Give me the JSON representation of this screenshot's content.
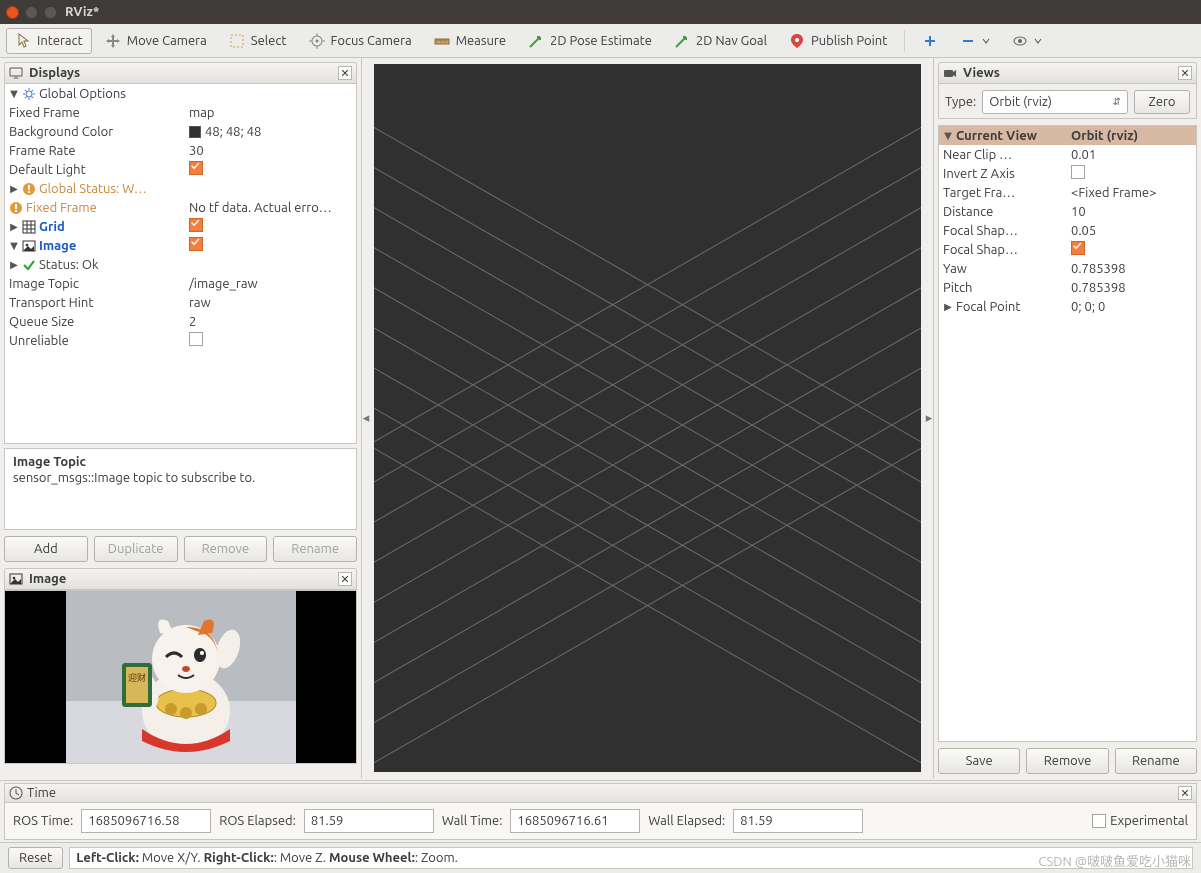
{
  "window": {
    "title": "RViz*"
  },
  "toolbar": {
    "interact": "Interact",
    "move_camera": "Move Camera",
    "select": "Select",
    "focus_camera": "Focus Camera",
    "measure": "Measure",
    "pose_estimate": "2D Pose Estimate",
    "nav_goal": "2D Nav Goal",
    "publish_point": "Publish Point"
  },
  "displays": {
    "title": "Displays",
    "global_options": {
      "label": "Global Options",
      "fixed_frame": {
        "label": "Fixed Frame",
        "value": "map"
      },
      "background_color": {
        "label": "Background Color",
        "value": "48; 48; 48"
      },
      "frame_rate": {
        "label": "Frame Rate",
        "value": "30"
      },
      "default_light": {
        "label": "Default Light",
        "checked": true
      }
    },
    "global_status": {
      "label": "Global Status: W…",
      "fixed_frame": {
        "label": "Fixed Frame",
        "value": "No tf data.  Actual erro…"
      }
    },
    "grid": {
      "label": "Grid",
      "checked": true
    },
    "image": {
      "label": "Image",
      "checked": true,
      "status": {
        "label": "Status: Ok"
      },
      "image_topic": {
        "label": "Image Topic",
        "value": "/image_raw"
      },
      "transport_hint": {
        "label": "Transport Hint",
        "value": "raw"
      },
      "queue_size": {
        "label": "Queue Size",
        "value": "2"
      },
      "unreliable": {
        "label": "Unreliable",
        "checked": false
      }
    },
    "help": {
      "title": "Image Topic",
      "body": "sensor_msgs::Image topic to subscribe to."
    },
    "buttons": {
      "add": "Add",
      "duplicate": "Duplicate",
      "remove": "Remove",
      "rename": "Rename"
    }
  },
  "image_panel": {
    "title": "Image"
  },
  "views": {
    "title": "Views",
    "type_label": "Type:",
    "type_value": "Orbit (rviz)",
    "zero": "Zero",
    "header": {
      "name": "Current View",
      "value": "Orbit (rviz)"
    },
    "rows": {
      "near_clip": {
        "label": "Near Clip …",
        "value": "0.01"
      },
      "invert_z": {
        "label": "Invert Z Axis",
        "checked": false
      },
      "target_frame": {
        "label": "Target Fra…",
        "value": "<Fixed Frame>"
      },
      "distance": {
        "label": "Distance",
        "value": "10"
      },
      "focal_ssize": {
        "label": "Focal Shap…",
        "value": "0.05"
      },
      "focal_sfixed": {
        "label": "Focal Shap…",
        "checked": true
      },
      "yaw": {
        "label": "Yaw",
        "value": "0.785398"
      },
      "pitch": {
        "label": "Pitch",
        "value": "0.785398"
      },
      "focal_point": {
        "label": "Focal Point",
        "value": "0; 0; 0"
      }
    },
    "buttons": {
      "save": "Save",
      "remove": "Remove",
      "rename": "Rename"
    }
  },
  "time": {
    "title": "Time",
    "ros_time_label": "ROS Time:",
    "ros_time": "1685096716.58",
    "ros_elapsed_label": "ROS Elapsed:",
    "ros_elapsed": "81.59",
    "wall_time_label": "Wall Time:",
    "wall_time": "1685096716.61",
    "wall_elapsed_label": "Wall Elapsed:",
    "wall_elapsed": "81.59",
    "experimental": "Experimental"
  },
  "status": {
    "reset": "Reset",
    "hint_prefix1": "Left-Click:",
    "hint_text1": " Move X/Y. ",
    "hint_prefix2": "Right-Click:",
    "hint_text2": ": Move Z. ",
    "hint_prefix3": "Mouse Wheel:",
    "hint_text3": ": Zoom."
  },
  "watermark": "CSDN @啵啵鱼爱吃小猫咪"
}
